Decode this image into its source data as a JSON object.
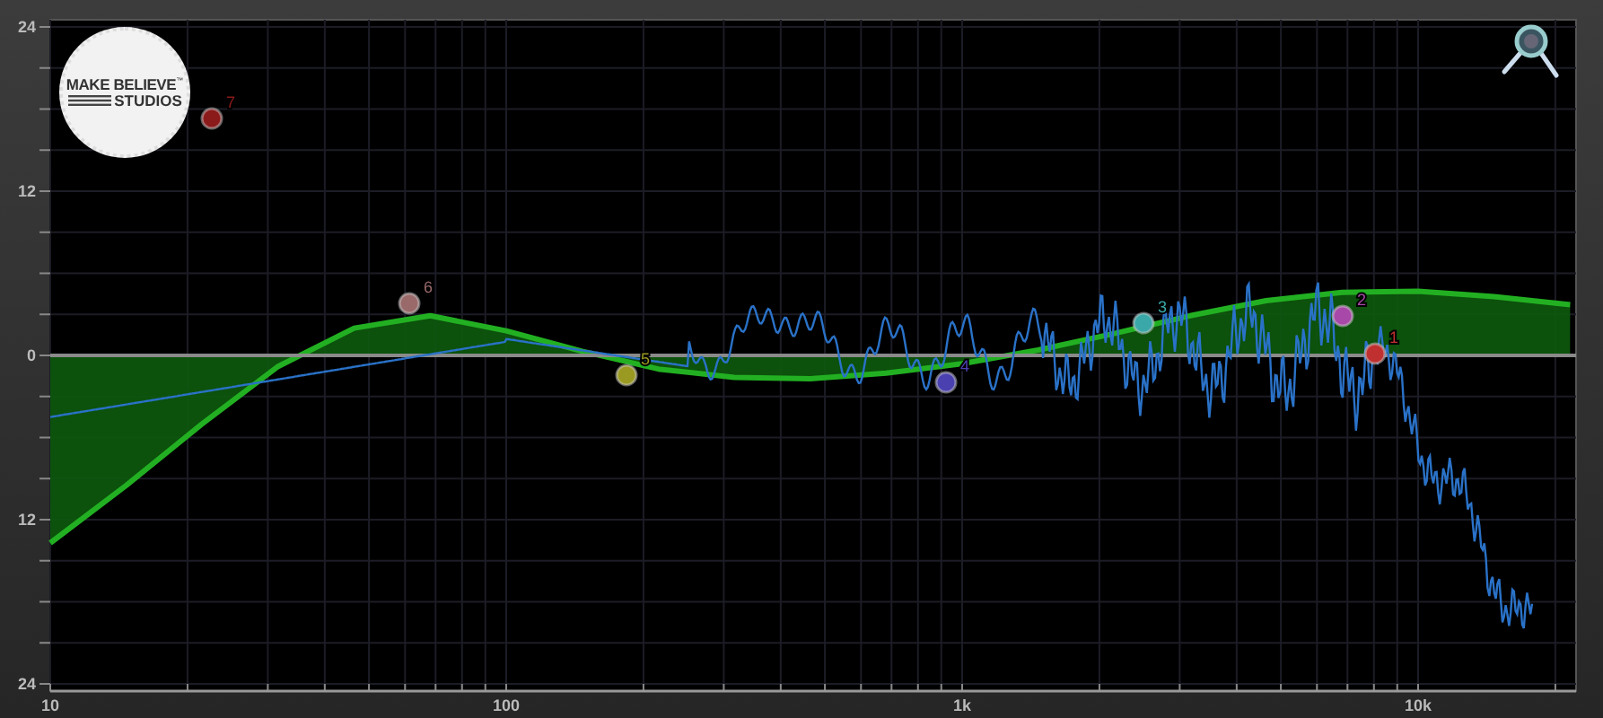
{
  "logo": {
    "line1": "MAKE BELIEVE",
    "trademark": "™",
    "line2": "STUDIOS"
  },
  "chart_data": {
    "type": "line",
    "grid": true,
    "ylim": [
      -24,
      24
    ],
    "categories": [
      "10",
      null,
      null,
      null,
      null,
      null,
      "100",
      null,
      null,
      null,
      null,
      null,
      "1k",
      null,
      null,
      null,
      null,
      null,
      "10k",
      null,
      null
    ],
    "series": [
      {
        "color": "#22b022",
        "values": [
          -13.7,
          -9.5,
          -5,
          -0.8,
          2,
          2.9,
          1.8,
          0.3,
          -1,
          -1.6,
          -1.7,
          -1.3,
          -0.6,
          0.4,
          1.6,
          2.9,
          4,
          4.6,
          4.7,
          4.3,
          3.7
        ]
      }
    ],
    "yticks": [
      {
        "value": 24,
        "label": "24"
      },
      {
        "value": 12,
        "label": "12"
      },
      {
        "value": 0,
        "label": "0"
      },
      {
        "value": -12,
        "label": "12"
      },
      {
        "value": -24,
        "label": "24"
      }
    ]
  },
  "bands": [
    {
      "label": "1",
      "color": "#c03030"
    },
    {
      "label": "2",
      "color": "#a848a8"
    },
    {
      "label": "3",
      "color": "#3aa8a8"
    },
    {
      "label": "4",
      "color": "#4a40b0"
    },
    {
      "label": "5",
      "color": "#9a9a22"
    },
    {
      "label": "6",
      "color": "#9a6a6a"
    },
    {
      "label": "7",
      "color": "#8b1a1a"
    }
  ]
}
